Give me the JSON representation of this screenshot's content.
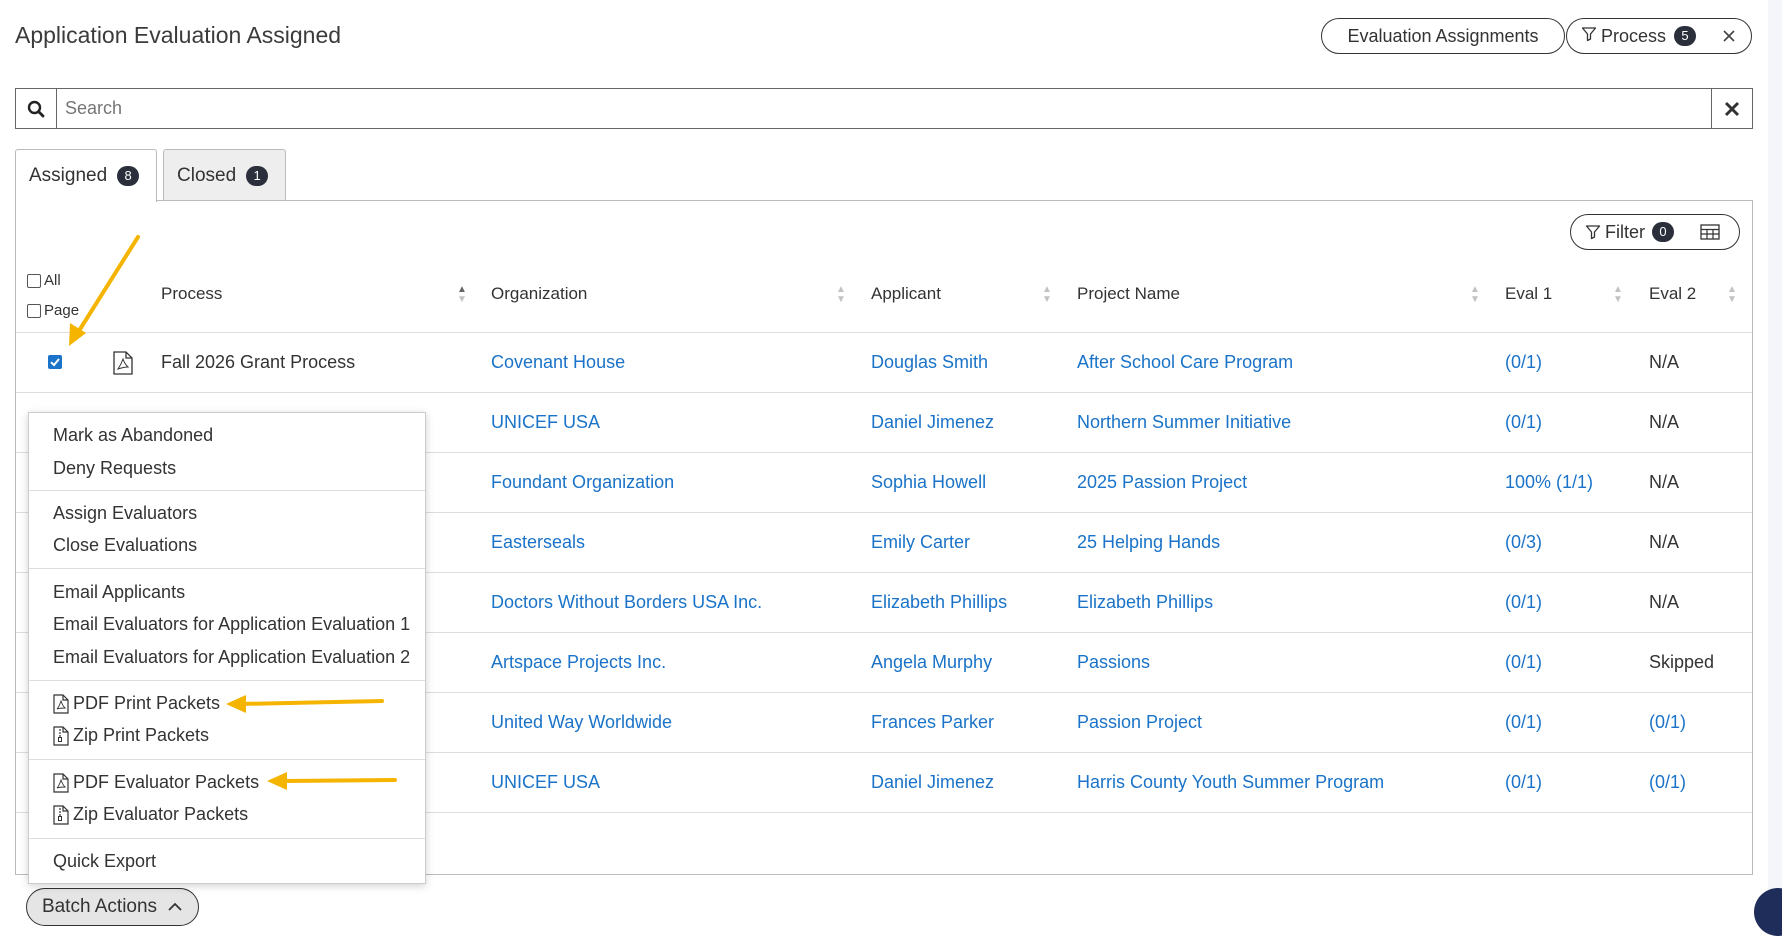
{
  "page": {
    "title": "Application Evaluation Assigned",
    "eval_assignments_label": "Evaluation Assignments",
    "process_label": "Process",
    "process_count": "5"
  },
  "search": {
    "placeholder": "Search"
  },
  "tabs": [
    {
      "label": "Assigned",
      "count": "8"
    },
    {
      "label": "Closed",
      "count": "1"
    }
  ],
  "toolbar": {
    "filter_label": "Filter",
    "filter_count": "0"
  },
  "select": {
    "all_label": "All",
    "page_label": "Page"
  },
  "columns": [
    "Process",
    "Organization",
    "Applicant",
    "Project Name",
    "Eval 1",
    "Eval 2"
  ],
  "rows": [
    {
      "process": "Fall 2026 Grant Process",
      "organization": "Covenant House",
      "applicant": "Douglas Smith",
      "project": "After School Care Program",
      "eval1": "(0/1)",
      "eval2": "N/A"
    },
    {
      "process": "",
      "organization": "UNICEF USA",
      "applicant": "Daniel Jimenez",
      "project": "Northern Summer Initiative",
      "eval1": "(0/1)",
      "eval2": "N/A"
    },
    {
      "process": "",
      "organization": "Foundant Organization",
      "applicant": "Sophia Howell",
      "project": "2025 Passion Project",
      "eval1": "100% (1/1)",
      "eval2": "N/A"
    },
    {
      "process": "",
      "organization": "Easterseals",
      "applicant": "Emily Carter",
      "project": "25 Helping Hands",
      "eval1": "(0/3)",
      "eval2": "N/A"
    },
    {
      "process": "",
      "organization": "Doctors Without Borders USA Inc.",
      "applicant": "Elizabeth Phillips",
      "project": "Elizabeth Phillips",
      "eval1": "(0/1)",
      "eval2": "N/A"
    },
    {
      "process": "",
      "organization": "Artspace Projects Inc.",
      "applicant": "Angela Murphy",
      "project": "Passions",
      "eval1": "(0/1)",
      "eval2": "Skipped"
    },
    {
      "process": "",
      "organization": "United Way Worldwide",
      "applicant": "Frances Parker",
      "project": "Passion Project",
      "eval1": "(0/1)",
      "eval2": "(0/1)"
    },
    {
      "process": "",
      "organization": "UNICEF USA",
      "applicant": "Daniel Jimenez",
      "project": "Harris County Youth Summer Program",
      "eval1": "(0/1)",
      "eval2": "(0/1)"
    }
  ],
  "batch_menu": {
    "groups": [
      [
        "Mark as Abandoned",
        "Deny Requests"
      ],
      [
        "Assign Evaluators",
        "Close Evaluations"
      ],
      [
        "Email Applicants",
        "Email Evaluators for Application Evaluation 1",
        "Email Evaluators for Application Evaluation 2"
      ],
      [
        "PDF Print Packets",
        "Zip Print Packets"
      ],
      [
        "PDF Evaluator Packets",
        "Zip Evaluator Packets"
      ],
      [
        "Quick Export"
      ]
    ]
  },
  "batch_button": {
    "label": "Batch Actions"
  },
  "colors": {
    "link": "#1a73c8",
    "badge": "#2a2f3b",
    "annotation_arrow": "#f5b400",
    "checkbox_checked": "#1a73c8"
  }
}
